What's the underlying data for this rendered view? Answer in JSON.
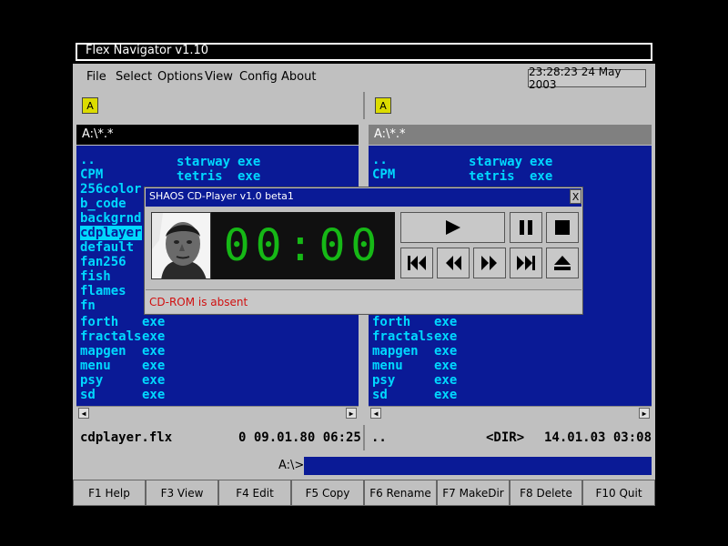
{
  "app": {
    "title": "Flex Navigator v1.10"
  },
  "menu": {
    "items": [
      "File",
      "Select",
      "Options",
      "View",
      "Config",
      "About"
    ],
    "clock": "23:28:23 24 May 2003"
  },
  "left_panel": {
    "drive": "A",
    "path": "A:\\*.*",
    "files_col1": [
      {
        "name": "..",
        "ext": ""
      },
      {
        "name": "CPM",
        "ext": ""
      },
      {
        "name": "256color",
        "ext": ""
      },
      {
        "name": "b_code",
        "ext": ""
      },
      {
        "name": "backgrnd",
        "ext": ""
      },
      {
        "name": "cdplayer",
        "ext": ""
      },
      {
        "name": "default",
        "ext": ""
      },
      {
        "name": "fan256",
        "ext": ""
      },
      {
        "name": "fish",
        "ext": ""
      },
      {
        "name": "flames",
        "ext": ""
      },
      {
        "name": "fn",
        "ext": ""
      },
      {
        "name": "forth",
        "ext": "exe"
      },
      {
        "name": "fractals",
        "ext": "exe"
      },
      {
        "name": "mapgen",
        "ext": "exe"
      },
      {
        "name": "menu",
        "ext": "exe"
      },
      {
        "name": "psy",
        "ext": "exe"
      },
      {
        "name": "sd",
        "ext": "exe"
      }
    ],
    "files_col2": [
      {
        "name": "starway",
        "ext": "exe"
      },
      {
        "name": "tetris",
        "ext": "exe"
      }
    ],
    "status_file": "cdplayer.flx",
    "status_info": "0 09.01.80 06:25"
  },
  "right_panel": {
    "drive": "A",
    "path": "A:\\*.*",
    "files_col1": [
      {
        "name": "..",
        "ext": ""
      },
      {
        "name": "CPM",
        "ext": ""
      },
      {
        "name": "forth",
        "ext": "exe"
      },
      {
        "name": "fractals",
        "ext": "exe"
      },
      {
        "name": "mapgen",
        "ext": "exe"
      },
      {
        "name": "menu",
        "ext": "exe"
      },
      {
        "name": "psy",
        "ext": "exe"
      },
      {
        "name": "sd",
        "ext": "exe"
      }
    ],
    "files_col2": [
      {
        "name": "starway",
        "ext": "exe"
      },
      {
        "name": "tetris",
        "ext": "exe"
      }
    ],
    "status_file": "..",
    "status_dir": "<DIR>",
    "status_info": "14.01.03 03:08"
  },
  "command_line": {
    "prompt": "A:\\>",
    "value": ""
  },
  "fkeys": [
    "F1 Help",
    "F3 View",
    "F4 Edit",
    "F5 Copy",
    "F6 Rename",
    "F7 MakeDir",
    "F8 Delete",
    "F10 Quit"
  ],
  "cd_player": {
    "title": "SHAOS CD-Player v1.0 beta1",
    "close": "X",
    "time": "00:00",
    "message": "CD-ROM is absent",
    "buttons": [
      "play-icon",
      "pause-icon",
      "stop-icon",
      "skip-back-icon",
      "rewind-icon",
      "fast-forward-icon",
      "skip-forward-icon",
      "eject-icon"
    ]
  },
  "colors": {
    "panel": "#0a1a96",
    "file_text": "#00d8ff",
    "display_digits": "#16b816",
    "error_text": "#d01010"
  }
}
